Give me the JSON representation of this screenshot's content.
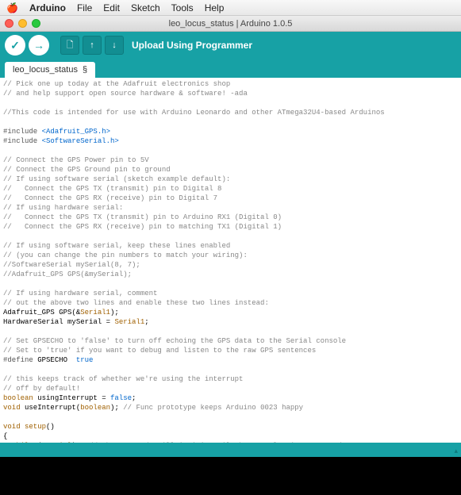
{
  "menubar": {
    "app_name": "Arduino",
    "items": [
      "File",
      "Edit",
      "Sketch",
      "Tools",
      "Help"
    ]
  },
  "window": {
    "title": "leo_locus_status | Arduino 1.0.5"
  },
  "toolbar": {
    "upload_label": "Upload Using Programmer"
  },
  "tab": {
    "name": "leo_locus_status",
    "modified": "§"
  },
  "code": {
    "l1": "// Pick one up today at the Adafruit electronics shop",
    "l2": "// and help support open source hardware & software! -ada",
    "l3": "",
    "l4": "//This code is intended for use with Arduino Leonardo and other ATmega32U4-based Arduinos",
    "l5": "",
    "l6a": "#include ",
    "l6b": "<Adafruit_GPS.h>",
    "l7a": "#include ",
    "l7b": "<SoftwareSerial.h>",
    "l8": "",
    "l9": "// Connect the GPS Power pin to 5V",
    "l10": "// Connect the GPS Ground pin to ground",
    "l11": "// If using software serial (sketch example default):",
    "l12": "//   Connect the GPS TX (transmit) pin to Digital 8",
    "l13": "//   Connect the GPS RX (receive) pin to Digital 7",
    "l14": "// If using hardware serial:",
    "l15": "//   Connect the GPS TX (transmit) pin to Arduino RX1 (Digital 0)",
    "l16": "//   Connect the GPS RX (receive) pin to matching TX1 (Digital 1)",
    "l17": "",
    "l18": "// If using software serial, keep these lines enabled",
    "l19": "// (you can change the pin numbers to match your wiring):",
    "l20": "//SoftwareSerial mySerial(8, 7);",
    "l21": "//Adafruit_GPS GPS(&mySerial);",
    "l22": "",
    "l23": "// If using hardware serial, comment",
    "l24": "// out the above two lines and enable these two lines instead:",
    "l25a": "Adafruit_GPS GPS(&",
    "l25b": "Serial1",
    "l25c": ");",
    "l26a": "HardwareSerial mySerial = ",
    "l26b": "Serial1",
    "l26c": ";",
    "l27": "",
    "l28": "// Set GPSECHO to 'false' to turn off echoing the GPS data to the Serial console",
    "l29": "// Set to 'true' if you want to debug and listen to the raw GPS sentences",
    "l30a": "#define",
    "l30b": " GPSECHO  ",
    "l30c": "true",
    "l31": "",
    "l32": "// this keeps track of whether we're using the interrupt",
    "l33": "// off by default!",
    "l34a": "boolean",
    "l34b": " usingInterrupt = ",
    "l34c": "false",
    "l34d": ";",
    "l35a": "void",
    "l35b": " useInterrupt(",
    "l35c": "boolean",
    "l35d": "); ",
    "l35e": "// Func prototype keeps Arduino 0023 happy",
    "l36": "",
    "l37a": "void",
    "l37b": " setup",
    "l37c": "()",
    "l38": "{",
    "l39a": "  ",
    "l39b": "while",
    "l39c": " (!",
    "l39d": "Serial",
    "l39e": ");  ",
    "l39f": "// the Leonardo will 'wait' until the USB plug is connected"
  }
}
